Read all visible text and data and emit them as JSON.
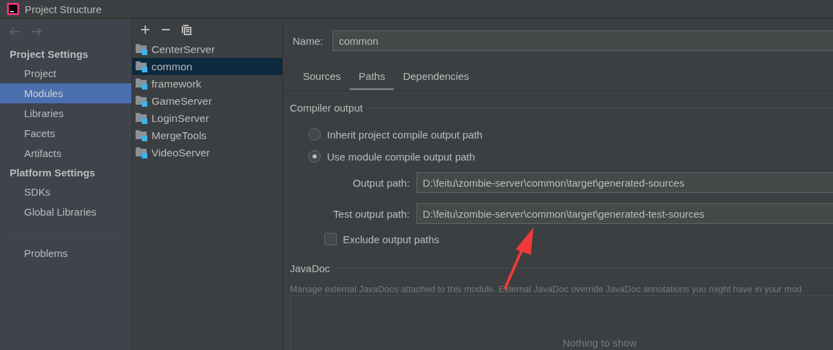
{
  "window": {
    "title": "Project Structure"
  },
  "sidebar": {
    "nav": [
      {
        "kind": "back",
        "disabled": true
      },
      {
        "kind": "forward",
        "disabled": true
      }
    ],
    "groups": [
      {
        "heading": "Project Settings",
        "items": [
          {
            "label": "Project",
            "selected": false
          },
          {
            "label": "Modules",
            "selected": true
          },
          {
            "label": "Libraries",
            "selected": false
          },
          {
            "label": "Facets",
            "selected": false
          },
          {
            "label": "Artifacts",
            "selected": false
          }
        ]
      },
      {
        "heading": "Platform Settings",
        "items": [
          {
            "label": "SDKs",
            "selected": false
          },
          {
            "label": "Global Libraries",
            "selected": false
          }
        ]
      },
      {
        "items": [
          {
            "label": "Problems",
            "selected": false
          }
        ]
      }
    ]
  },
  "modules": {
    "toolbar": [
      {
        "kind": "add"
      },
      {
        "kind": "remove"
      },
      {
        "kind": "copy"
      }
    ],
    "items": [
      {
        "label": "CenterServer",
        "selected": false
      },
      {
        "label": "common",
        "selected": true
      },
      {
        "label": "framework",
        "selected": false
      },
      {
        "label": "GameServer",
        "selected": false
      },
      {
        "label": "LoginServer",
        "selected": false
      },
      {
        "label": "MergeTools",
        "selected": false
      },
      {
        "label": "VideoServer",
        "selected": false
      }
    ]
  },
  "details": {
    "name_label": "Name:",
    "name_value": "common",
    "tabs": [
      {
        "label": "Sources",
        "selected": false
      },
      {
        "label": "Paths",
        "selected": true
      },
      {
        "label": "Dependencies",
        "selected": false
      }
    ],
    "compiler_output": {
      "title": "Compiler output",
      "options": [
        {
          "label": "Inherit project compile output path",
          "selected": false
        },
        {
          "label": "Use module compile output path",
          "selected": true
        }
      ],
      "paths": [
        {
          "label": "Output path:",
          "value": "D:\\feitu\\zombie-server\\common\\target\\generated-sources"
        },
        {
          "label": "Test output path:",
          "value": "D:\\feitu\\zombie-server\\common\\target\\generated-test-sources"
        }
      ],
      "exclude": {
        "label": "Exclude output paths",
        "checked": false
      }
    },
    "javadoc": {
      "title": "JavaDoc",
      "description": "Manage external JavaDocs attached to this module. External JavaDoc override JavaDoc annotations you might have in your mod",
      "empty_text": "Nothing to show"
    }
  }
}
